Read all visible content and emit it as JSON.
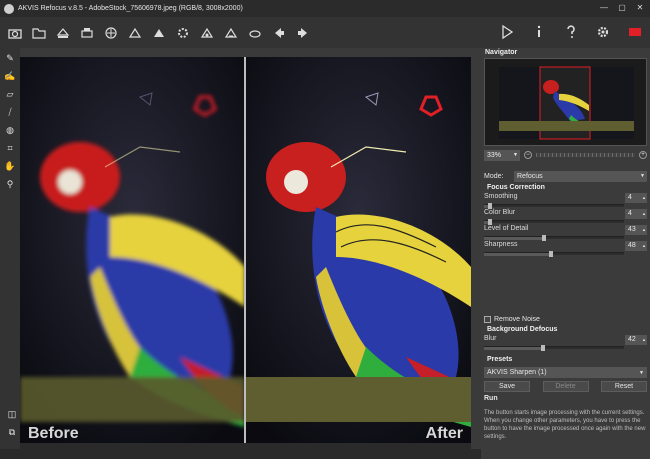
{
  "window": {
    "title": "AKVIS Refocus v.8.5 - AdobeStock_75606978.jpeg (RGB/8, 3008x2000)",
    "buttons": [
      "—",
      "▢",
      "✕"
    ]
  },
  "toolbar": {
    "left_icons": [
      "camera-icon",
      "open-icon",
      "save-icon",
      "print-icon",
      "share-icon",
      "batch-icon",
      "preferences-icon",
      "plugin-icon",
      "settings-icon",
      "share2-icon",
      "undo-icon",
      "back-icon",
      "forward-icon"
    ],
    "right_icons": [
      "run-icon",
      "info-icon",
      "help-icon",
      "gear-icon",
      "flag-icon"
    ]
  },
  "left_tools": [
    "selection-icon",
    "brush-icon",
    "eraser-icon",
    "tube-icon",
    "blur-icon",
    "crop-icon",
    "hand-icon",
    "zoom-icon"
  ],
  "canvas": {
    "before_label": "Before",
    "after_label": "After"
  },
  "navigator": {
    "title": "Navigator",
    "zoom": "33%"
  },
  "mode": {
    "label": "Mode:",
    "value": "Refocus"
  },
  "focus_correction": {
    "title": "Focus Correction",
    "params": [
      {
        "label": "Smoothing",
        "value": "4",
        "fraction": 0.04
      },
      {
        "label": "Color Blur",
        "value": "4",
        "fraction": 0.04
      },
      {
        "label": "Level of Detail",
        "value": "43",
        "fraction": 0.43
      },
      {
        "label": "Sharpness",
        "value": "48",
        "fraction": 0.48
      }
    ]
  },
  "remove_noise": {
    "label": "Remove Noise"
  },
  "background_defocus": {
    "title": "Background Defocus",
    "blur_label": "Blur",
    "blur_value": "42",
    "blur_fraction": 0.42
  },
  "presets": {
    "title": "Presets",
    "selected": "AKVIS Sharpen (1)",
    "save": "Save",
    "delete": "Delete",
    "reset": "Reset"
  },
  "run": {
    "title": "Run",
    "text": "The button starts image processing with the current settings. When you change other parameters, you have to press the button to have the image processed once again with the new settings."
  },
  "colors": {
    "accent": "#e01f26",
    "panel": "#3b3b3b"
  }
}
